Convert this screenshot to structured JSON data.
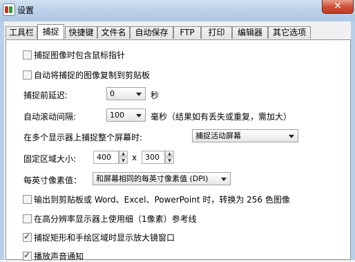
{
  "window": {
    "title": "设置",
    "close_glyph": "✕"
  },
  "tabs": [
    "工具栏",
    "捕捉",
    "快捷键",
    "文件名",
    "自动保存",
    "FTP",
    "打印",
    "编辑器",
    "其它选项"
  ],
  "active_tab": "捕捉",
  "options": {
    "include_cursor": {
      "label": "捕捉图像时包含鼠标指针",
      "checked": false
    },
    "copy_to_clipboard": {
      "label": "自动将捕捉的图像复制到剪贴板",
      "checked": false
    },
    "delay": {
      "label": "捕捉前延迟:",
      "value": "0",
      "unit": "秒"
    },
    "scroll_interval": {
      "label": "自动滚动间隔:",
      "value": "100",
      "unit": "毫秒（结果如有丢失或重复，需加大）"
    },
    "multi_monitor": {
      "label": "在多个显示器上捕捉整个屏幕时:",
      "value": "捕捉活动屏幕"
    },
    "fixed_size": {
      "label": "固定区域大小:",
      "width": "400",
      "separator": "x",
      "height": "300"
    },
    "dpi": {
      "label": "每英寸像素值：",
      "value": "和屏幕相同的每英寸像素值 (DPI)"
    },
    "convert_256": {
      "label": "输出到剪贴板或 Word、Excel、PowerPoint 时，转换为 256 色图像",
      "checked": false
    },
    "thin_lines": {
      "label": "在高分辨率显示器上使用细（1像素）参考线",
      "checked": false
    },
    "magnifier": {
      "label": "捕捉矩形和手绘区域时显示放大镜窗口",
      "checked": true
    },
    "sound": {
      "label": "播放声音通知",
      "checked": true
    }
  }
}
